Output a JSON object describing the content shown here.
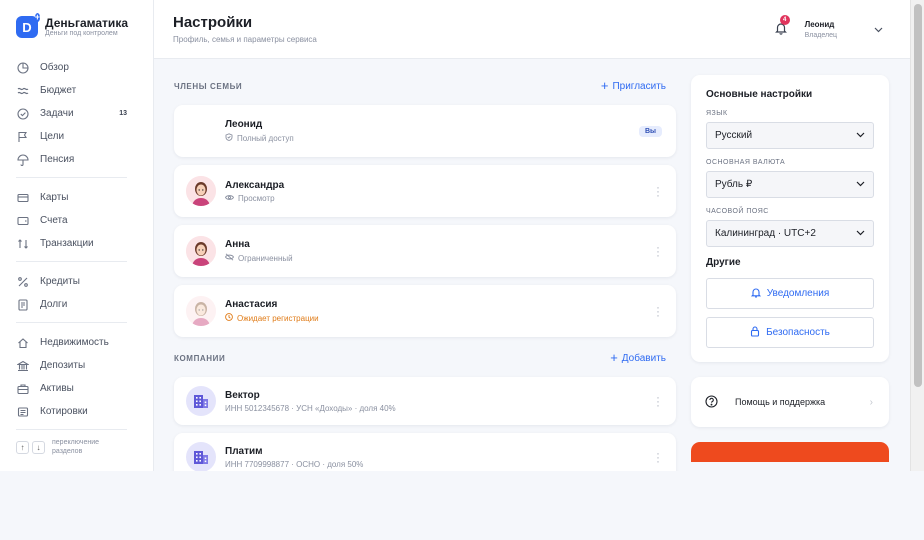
{
  "brand": {
    "name": "Деньгаматика",
    "tagline": "Деньги под контролем",
    "logo_letter": "D"
  },
  "sidebar": {
    "groups": [
      [
        {
          "label": "Обзор",
          "icon": "pie-chart-icon"
        },
        {
          "label": "Бюджет",
          "icon": "waves-icon"
        },
        {
          "label": "Задачи",
          "icon": "check-circle-icon",
          "count": "13"
        },
        {
          "label": "Цели",
          "icon": "flag-icon"
        },
        {
          "label": "Пенсия",
          "icon": "umbrella-icon"
        }
      ],
      [
        {
          "label": "Карты",
          "icon": "card-icon"
        },
        {
          "label": "Счета",
          "icon": "wallet-icon"
        },
        {
          "label": "Транзакции",
          "icon": "arrows-icon"
        }
      ],
      [
        {
          "label": "Кредиты",
          "icon": "percent-icon"
        },
        {
          "label": "Долги",
          "icon": "document-icon"
        }
      ],
      [
        {
          "label": "Недвижимость",
          "icon": "home-icon"
        },
        {
          "label": "Депозиты",
          "icon": "bank-icon"
        },
        {
          "label": "Активы",
          "icon": "briefcase-icon"
        },
        {
          "label": "Котировки",
          "icon": "news-icon"
        }
      ]
    ],
    "section_switch": {
      "line1": "переключение",
      "line2": "разделов"
    }
  },
  "header": {
    "title": "Настройки",
    "subtitle": "Профиль, семья и параметры сервиса",
    "notifications_count": "4",
    "user_name": "Леонид",
    "user_role": "Владелец"
  },
  "family": {
    "title": "ЧЛЕНЫ СЕМЬИ",
    "action": "Пригласить",
    "members": [
      {
        "name": "Леонид",
        "access": "Полный доступ",
        "badge": "Вы"
      },
      {
        "name": "Александра",
        "access": "Просмотр"
      },
      {
        "name": "Анна",
        "access": "Ограниченный"
      },
      {
        "name": "Анастасия",
        "access": "Ожидает регистрации"
      }
    ]
  },
  "companies": {
    "title": "КОМПАНИИ",
    "action": "Добавить",
    "items": [
      {
        "name": "Вектор",
        "details": "ИНН 5012345678 · УСН «Доходы» · доля 40%"
      },
      {
        "name": "Платим",
        "details": "ИНН 7709998877 · ОСНО · доля 50%"
      }
    ]
  },
  "settings": {
    "title": "Основные настройки",
    "language_label": "ЯЗЫК",
    "language_value": "Русский",
    "currency_label": "ОСНОВНАЯ ВАЛЮТА",
    "currency_value": "Рубль ₽",
    "timezone_label": "ЧАСОВОЙ ПОЯС",
    "timezone_value": "Калининград · UTC+2",
    "other_title": "Другие",
    "notifications_button": "Уведомления",
    "security_button": "Безопасность"
  },
  "help": {
    "label": "Помощь и поддержка"
  },
  "colors": {
    "accent": "#2f6bf2",
    "danger": "#ee4a1e",
    "warning": "#e07b17",
    "badge": "#e0345c"
  }
}
